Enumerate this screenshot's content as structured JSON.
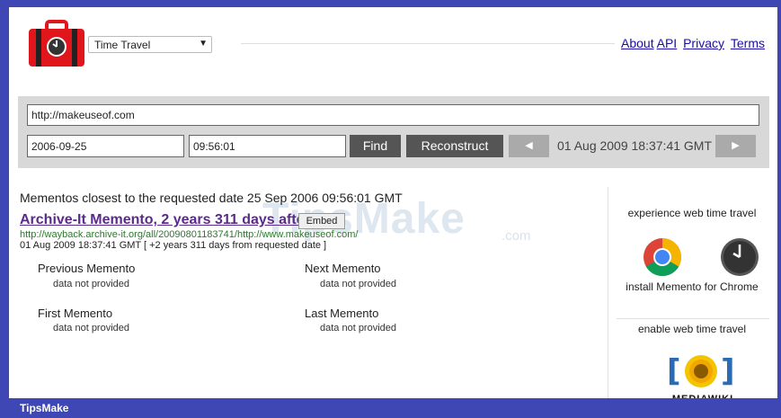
{
  "header": {
    "mode_select_value": "Time Travel",
    "links": [
      "About",
      "API",
      "Privacy",
      "Terms"
    ]
  },
  "search": {
    "url_value": "http://makeuseof.com",
    "date_value": "2006-09-25",
    "time_value": "09:56:01",
    "find_label": "Find",
    "reconstruct_label": "Reconstruct",
    "prev_label": "◀",
    "next_label": "▶",
    "nav_date": "01 Aug 2009 18:37:41 GMT"
  },
  "results": {
    "closest_text": "Mementos closest to the requested date 25 Sep 2006 09:56:01 GMT",
    "memento_title": "Archive-It Memento, 2 years 311 days after",
    "embed_label": "Embed",
    "memento_url": "http://wayback.archive-it.org/all/20090801183741/http://www.makeuseof.com/",
    "memento_date": "01 Aug 2009 18:37:41 GMT  [ +2 years 311 days from requested date ]",
    "previous_label": "Previous Memento",
    "previous_value": "data not provided",
    "next_label": "Next Memento",
    "next_value": "data not provided",
    "first_label": "First Memento",
    "first_value": "data not provided",
    "last_label": "Last Memento",
    "last_value": "data not provided"
  },
  "sidebar": {
    "experience_title": "experience web time travel",
    "install_text": "install Memento for Chrome",
    "enable_title": "enable web time travel",
    "mediawiki_text": "MEDIAWIKI"
  },
  "watermark": {
    "main": "TipsMake",
    "suffix": ".com"
  },
  "footer": {
    "brand": "TipsMake"
  },
  "colors": {
    "frame": "#3f47b5",
    "logo_red": "#e0161c",
    "link": "#1a0dab",
    "visited": "#5b2a8a",
    "url_green": "#2a7a2a"
  }
}
